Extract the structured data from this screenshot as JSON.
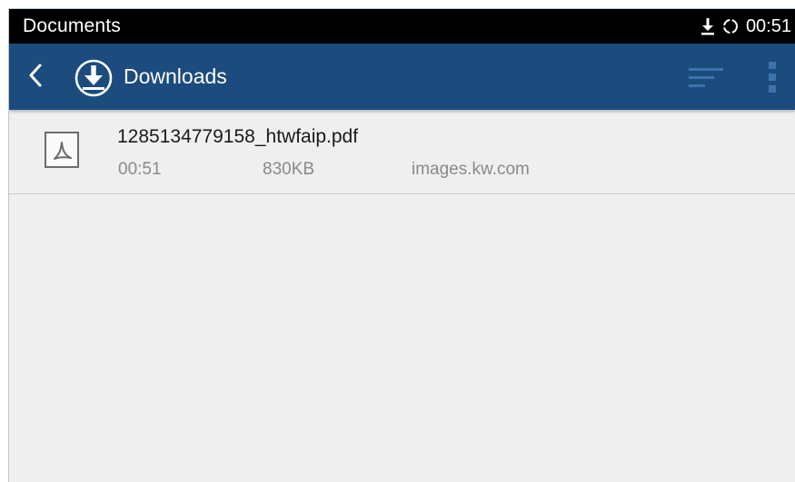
{
  "status_bar": {
    "app_name": "Documents",
    "time": "00:51",
    "icons": [
      "download-icon",
      "sync-icon"
    ]
  },
  "app_bar": {
    "title": "Downloads",
    "icons": [
      "back-arrow-icon",
      "download-circle-icon",
      "sort-icon",
      "more-vert-icon"
    ],
    "color": "#1c4b7e"
  },
  "downloads": [
    {
      "file_name": "1285134779158_htwfaip.pdf",
      "time": "00:51",
      "size": "830KB",
      "source": "images.kw.com",
      "icon": "pdf-file-icon"
    }
  ]
}
